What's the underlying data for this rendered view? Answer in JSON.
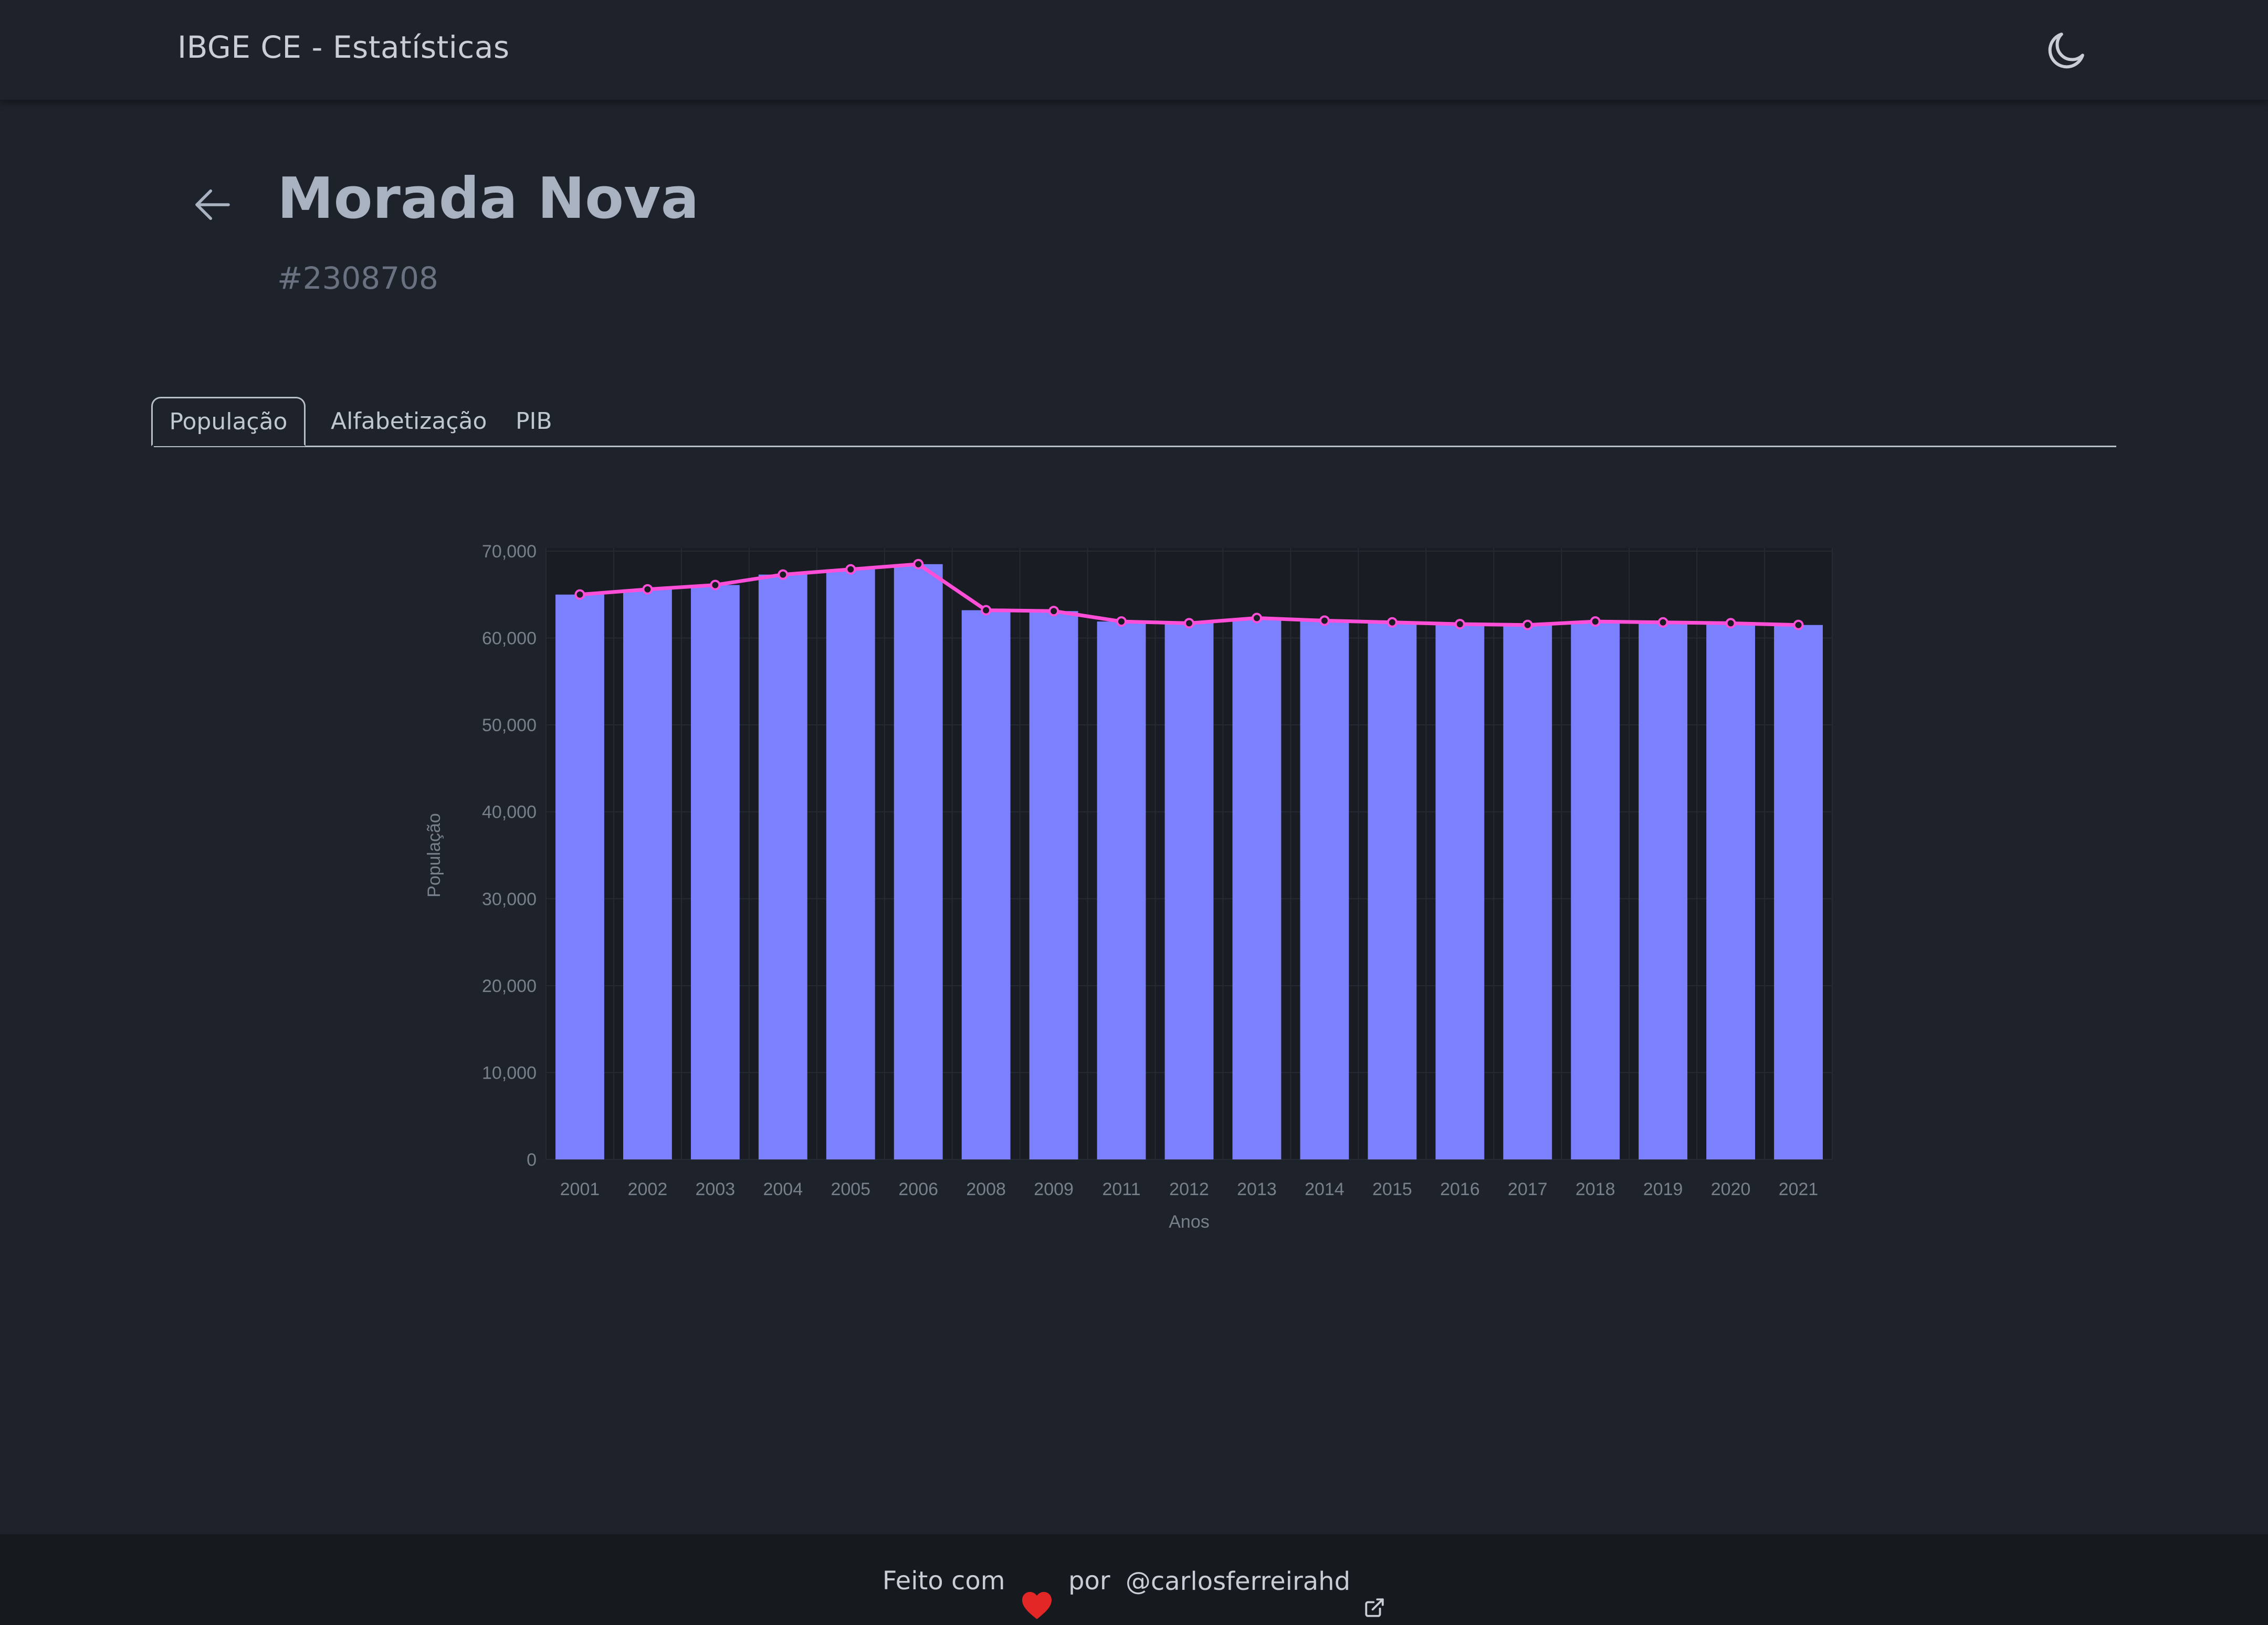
{
  "header": {
    "brand": "IBGE CE - Estatísticas",
    "theme_toggle_icon": "moon-icon"
  },
  "page": {
    "back_icon": "arrow-left-icon",
    "title": "Morada Nova",
    "subtitle": "#2308708"
  },
  "tabs": [
    {
      "label": "População",
      "active": true
    },
    {
      "label": "Alfabetização",
      "active": false
    },
    {
      "label": "PIB",
      "active": false
    }
  ],
  "chart_data": {
    "type": "bar",
    "categories": [
      "2001",
      "2002",
      "2003",
      "2004",
      "2005",
      "2006",
      "2008",
      "2009",
      "2011",
      "2012",
      "2013",
      "2014",
      "2015",
      "2016",
      "2017",
      "2018",
      "2019",
      "2020",
      "2021"
    ],
    "series": [
      {
        "type": "bar",
        "color": "#7b80ff",
        "values": [
          65000,
          65600,
          66100,
          67300,
          67900,
          68500,
          63200,
          63100,
          61900,
          61700,
          62300,
          62000,
          61800,
          61600,
          61500,
          61900,
          61800,
          61700,
          61500
        ]
      },
      {
        "type": "line",
        "color": "#ff4fd8",
        "values": [
          65000,
          65600,
          66100,
          67300,
          67900,
          68500,
          63200,
          63100,
          61900,
          61700,
          62300,
          62000,
          61800,
          61600,
          61500,
          61900,
          61800,
          61700,
          61500
        ]
      }
    ],
    "xlabel": "Anos",
    "ylabel": "População",
    "ylim": [
      0,
      70000
    ],
    "yticks": [
      0,
      10000,
      20000,
      30000,
      40000,
      50000,
      60000,
      70000
    ],
    "ytick_labels": [
      "0",
      "10,000",
      "20,000",
      "30,000",
      "40,000",
      "50,000",
      "60,000",
      "70,000"
    ],
    "grid": true,
    "colors": {
      "plot_bg": "#191c22",
      "grid": "#262a32",
      "tick_text": "#7a808b"
    }
  },
  "footer": {
    "made_with": "Feito com",
    "heart_icon": "heart-icon",
    "by": "por",
    "author": "@carlosferreirahd",
    "link_icon": "external-link-icon"
  }
}
